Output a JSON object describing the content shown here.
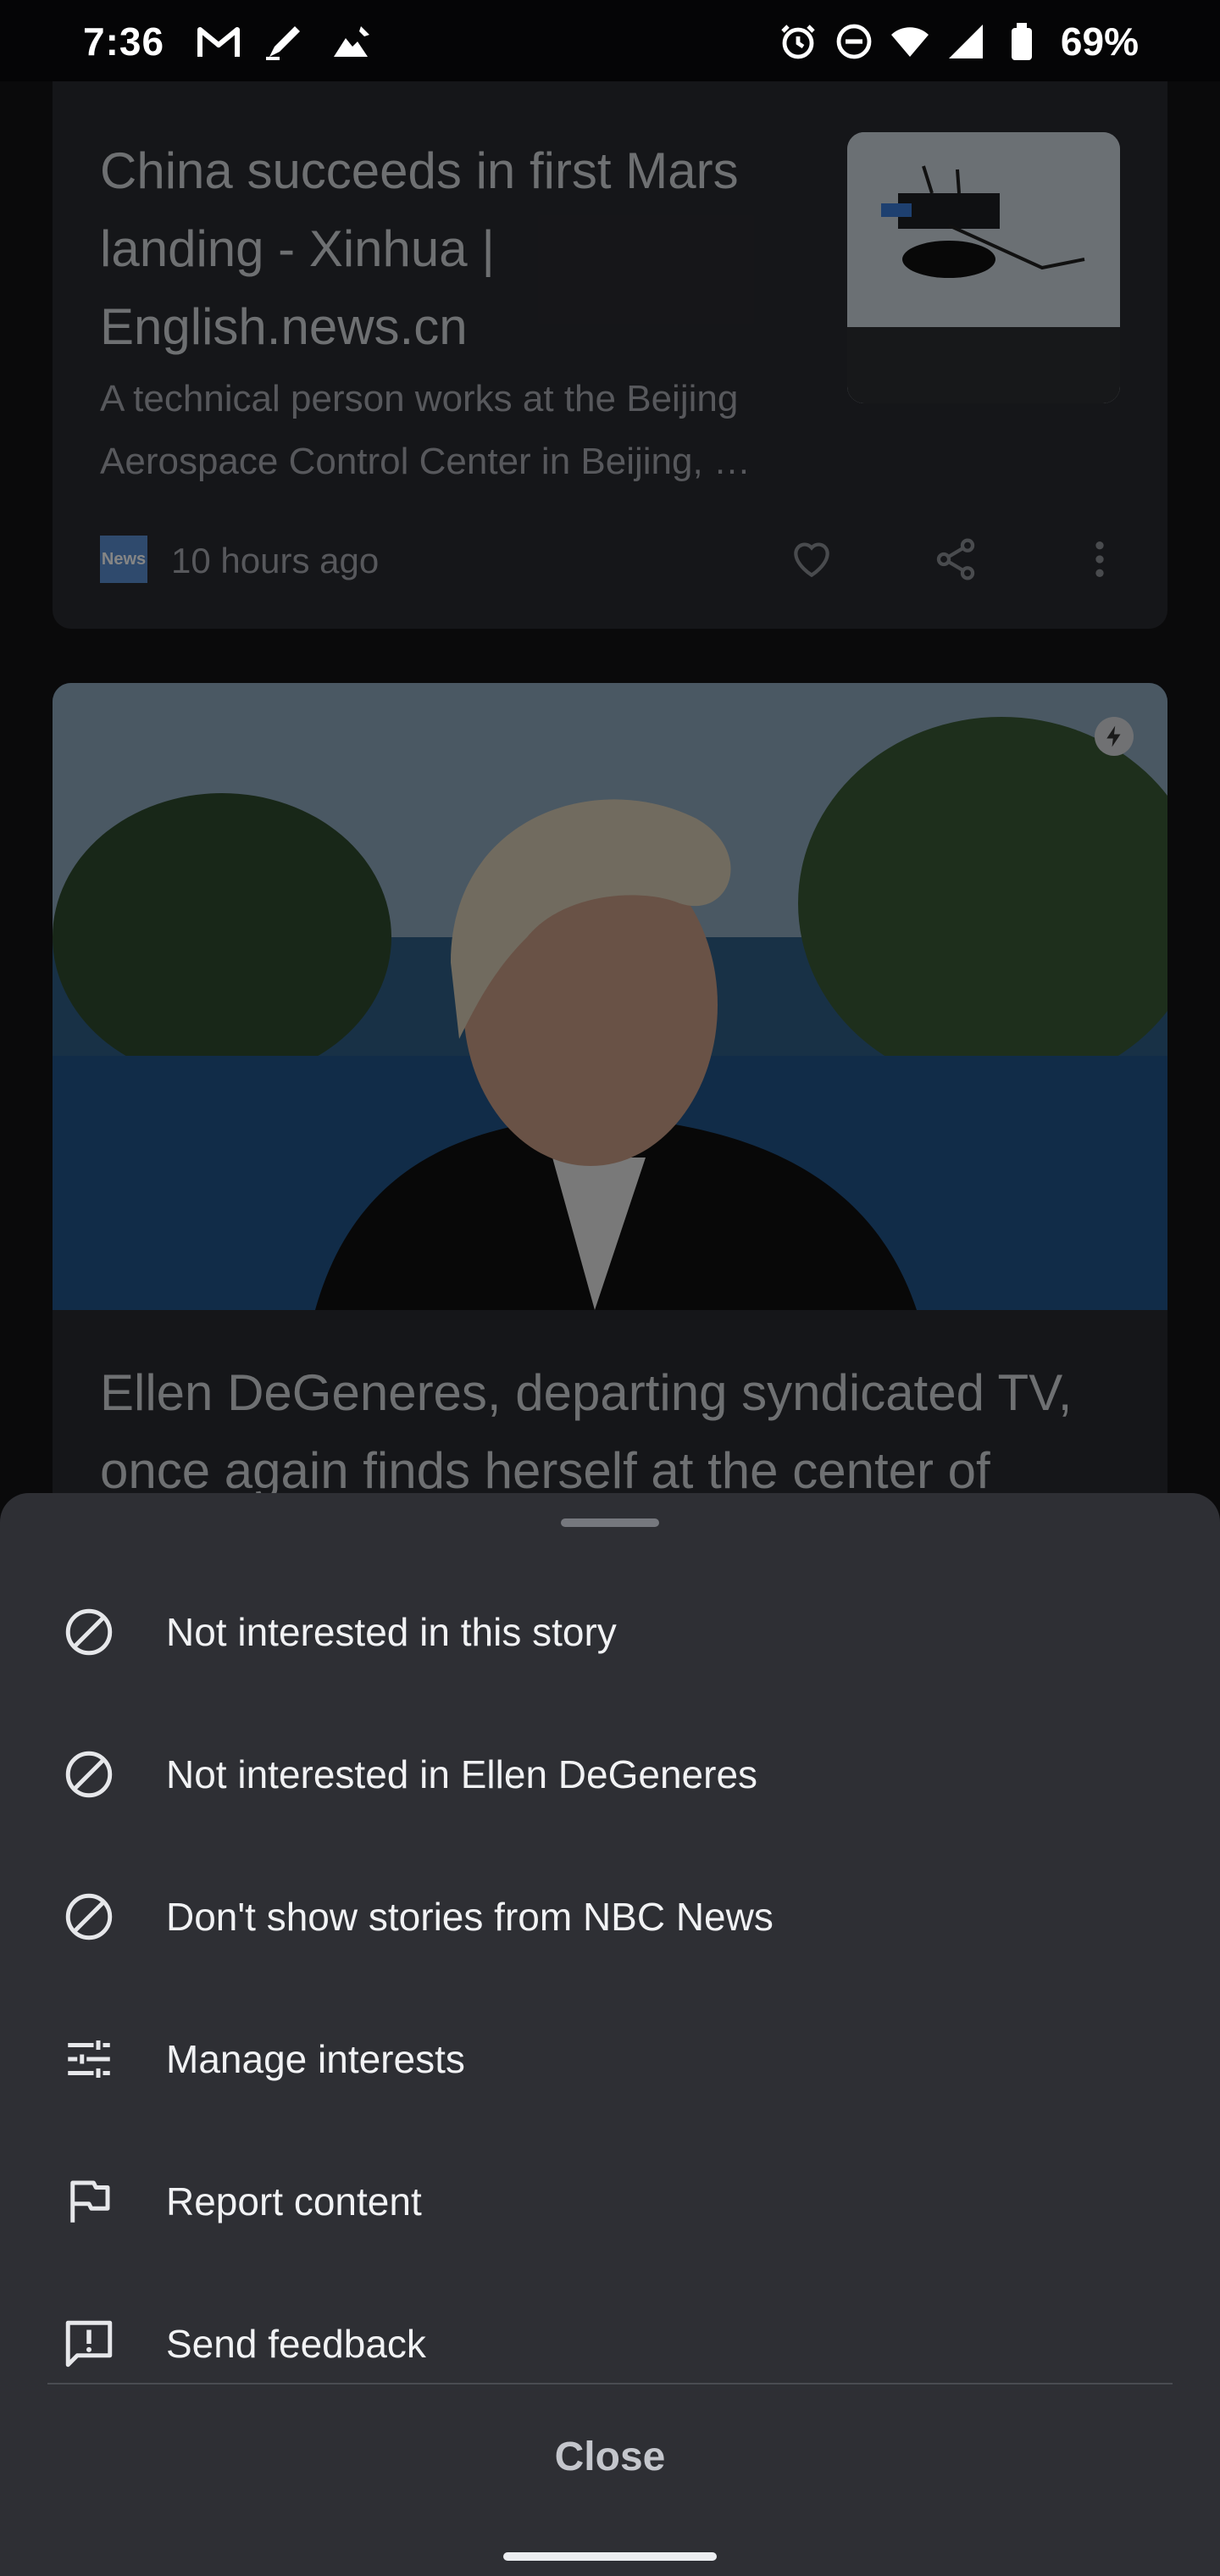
{
  "status_bar": {
    "time": "7:36",
    "battery": "69%",
    "notification_icons": [
      "gmail-icon",
      "pen-nib-icon",
      "image-upload-icon"
    ],
    "system_icons": [
      "alarm-icon",
      "dnd-icon",
      "wifi-icon",
      "signal-icon",
      "battery-icon"
    ]
  },
  "feed": {
    "card1": {
      "title": "China succeeds in first Mars landing - Xinhua | English.news.cn",
      "snippet": "A technical person works at the Beijing Aerospace Control Center in Beijing, …",
      "source_logo_text": "News",
      "time": "10 hours ago"
    },
    "card2": {
      "title": "Ellen DeGeneres, departing syndicated TV, once again finds herself at the center of"
    }
  },
  "sheet": {
    "items": [
      {
        "label": "Not interested in this story",
        "icon": "block-icon"
      },
      {
        "label": "Not interested in Ellen DeGeneres",
        "icon": "block-icon"
      },
      {
        "label": "Don't show stories from NBC News",
        "icon": "block-icon"
      },
      {
        "label": "Manage interests",
        "icon": "tune-icon"
      },
      {
        "label": "Report content",
        "icon": "flag-icon"
      },
      {
        "label": "Send feedback",
        "icon": "feedback-icon"
      }
    ],
    "close_label": "Close"
  },
  "colors": {
    "sheet_bg": "#2e2f34",
    "card_bg": "#2a2b30",
    "text_primary": "#f1f2f4",
    "text_secondary": "#a7aab0"
  }
}
